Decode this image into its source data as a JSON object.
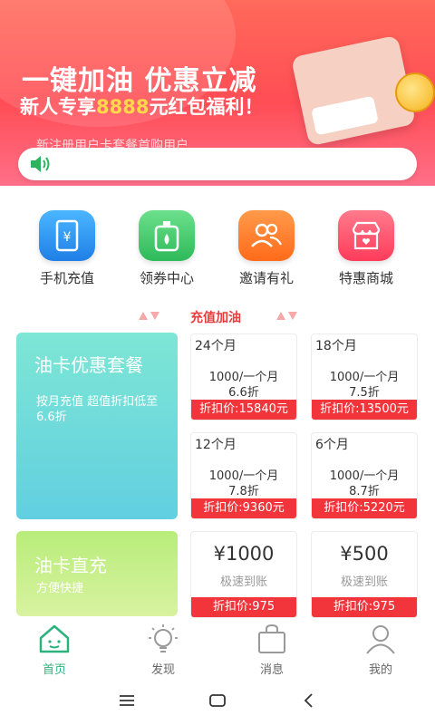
{
  "banner": {
    "title": "一键加油 优惠立减",
    "subtitle_prefix": "新人专享",
    "subtitle_amount": "8888",
    "subtitle_suffix": "元红包福利！",
    "promo_text": "新注册用户卡套餐首购用户"
  },
  "quick_menu": [
    {
      "label": "手机充值",
      "icon": "phone-recharge-icon",
      "color": "#2b8ef0"
    },
    {
      "label": "领券中心",
      "icon": "coupon-bottle-icon",
      "color": "#35c262"
    },
    {
      "label": "邀请有礼",
      "icon": "invite-people-icon",
      "color": "#ff7a2a"
    },
    {
      "label": "特惠商城",
      "icon": "mall-store-icon",
      "color": "#ff4d66"
    }
  ],
  "section_title": "充值加油",
  "left_cards": {
    "package": {
      "title": "油卡优惠套餐",
      "desc": "按月充值 超值折扣低至6.6折"
    },
    "direct": {
      "title": "油卡直充",
      "desc": "方便快捷"
    }
  },
  "packages": [
    {
      "months": "24个月",
      "price": "1000/一个月",
      "discount": "6.6折",
      "final": "折扣价:15840元"
    },
    {
      "months": "18个月",
      "price": "1000/一个月",
      "discount": "7.5折",
      "final": "折扣价:13500元"
    },
    {
      "months": "12个月",
      "price": "1000/一个月",
      "discount": "7.8折",
      "final": "折扣价:9360元"
    },
    {
      "months": "6个月",
      "price": "1000/一个月",
      "discount": "8.7折",
      "final": "折扣价:5220元"
    }
  ],
  "direct_cards": [
    {
      "amount": "¥1000",
      "speed": "极速到账",
      "final": "折扣价:975"
    },
    {
      "amount": "¥500",
      "speed": "极速到账",
      "final": "折扣价:975"
    }
  ],
  "tabs": [
    {
      "label": "首页",
      "icon": "home-icon",
      "active": true
    },
    {
      "label": "发现",
      "icon": "bulb-icon",
      "active": false
    },
    {
      "label": "消息",
      "icon": "bag-icon",
      "active": false
    },
    {
      "label": "我的",
      "icon": "user-icon",
      "active": false
    }
  ],
  "colors": {
    "accent_red": "#f2353b",
    "active_green": "#2bb37b"
  }
}
